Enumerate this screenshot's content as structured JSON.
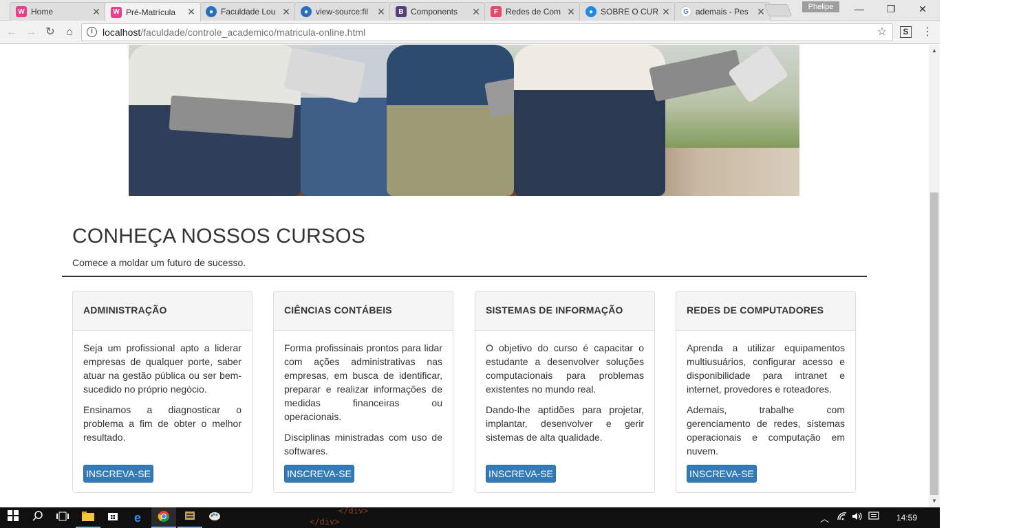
{
  "browser": {
    "tabs": [
      {
        "title": "Home",
        "favicon": "W",
        "color": "#e83e8c"
      },
      {
        "title": "Pré-Matrícula",
        "favicon": "W",
        "color": "#e83e8c"
      },
      {
        "title": "Faculdade Lou",
        "favicon": "●",
        "color": "#2a6ebb"
      },
      {
        "title": "view-source:fil",
        "favicon": "●",
        "color": "#2a6ebb"
      },
      {
        "title": "Components",
        "favicon": "B",
        "color": "#563d7c"
      },
      {
        "title": "Redes de Com",
        "favicon": "F",
        "color": "#e64a6b"
      },
      {
        "title": "SOBRE O CUR",
        "favicon": "●",
        "color": "#1e88e5"
      },
      {
        "title": "ademais - Pes",
        "favicon": "G",
        "color": "#4285f4"
      }
    ],
    "profile": "Phelipe",
    "url_host": "localhost",
    "url_path": "/faculdade/controle_academico/matricula-online.html",
    "minimize": "—",
    "restore": "❐",
    "close": "✕"
  },
  "section": {
    "title": "CONHEÇA NOSSOS CURSOS",
    "subtitle": "Comece a moldar um futuro de sucesso."
  },
  "courses": [
    {
      "name": "ADMINISTRAÇÃO",
      "paragraphs": [
        "Seja um profissional apto a liderar empresas de qualquer porte, saber atuar na gestão pública ou ser bem-sucedido no próprio negócio.",
        "Ensinamos a diagnosticar o problema a fim de obter o melhor resultado."
      ],
      "button": "INSCREVA-SE"
    },
    {
      "name": "CIÊNCIAS CONTÁBEIS",
      "paragraphs": [
        "Forma profissinais prontos para lidar com ações administrativas nas empresas, em busca de identificar, preparar e realizar informações de medidas financeiras ou operacionais.",
        "Disciplinas ministradas com uso de softwares."
      ],
      "button": "INSCREVA-SE"
    },
    {
      "name": "SISTEMAS DE INFORMAÇÃO",
      "paragraphs": [
        "O objetivo do curso é capacitar o estudante a desenvolver soluções computacionais para problemas existentes no mundo real.",
        "Dando-lhe aptidões para projetar, implantar, desenvolver e gerir sistemas de alta qualidade."
      ],
      "button": "INSCREVA-SE"
    },
    {
      "name": "REDES DE COMPUTADORES",
      "paragraphs": [
        "Aprenda a utilizar equipamentos multiusuários, configurar acesso e disponibilidade para intranet e internet, provedores e roteadores.",
        "Ademais, trabalhe com gerenciamento de redes, sistemas operacionais e computação em nuvem."
      ],
      "button": "INSCREVA-SE"
    }
  ],
  "taskbar": {
    "time": "14:59",
    "ghost_text_1": "</div>",
    "ghost_text_2": "</div>"
  },
  "accent": "#337ab7"
}
